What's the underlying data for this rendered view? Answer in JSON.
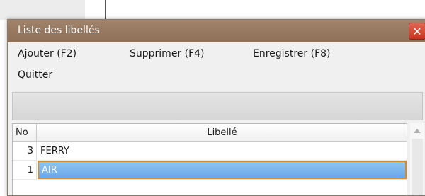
{
  "window": {
    "title": "Liste des libellés",
    "close_label": "✕"
  },
  "menu": {
    "items": [
      {
        "label": "Ajouter (F2)"
      },
      {
        "label": "Supprimer (F4)"
      },
      {
        "label": "Enregistrer (F8)"
      },
      {
        "label": "Quitter"
      }
    ]
  },
  "grid": {
    "columns": [
      "No",
      "Libellé"
    ],
    "rows": [
      {
        "no": "3",
        "libelle": "FERRY",
        "selected": false
      },
      {
        "no": "1",
        "libelle": "AIR",
        "selected": true
      }
    ]
  },
  "colors": {
    "titlebar": "#8e6f57",
    "selection": "#6aa9e8",
    "selection_border": "#d18a3a",
    "close": "#c7351f"
  }
}
